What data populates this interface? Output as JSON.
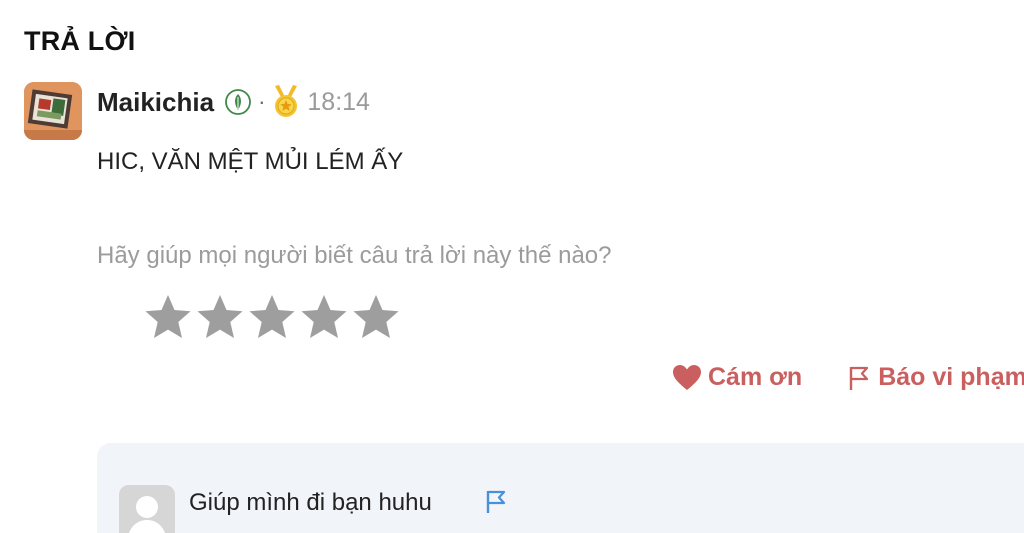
{
  "section": {
    "title": "TRẢ LỜI"
  },
  "answer": {
    "username": "Maikichia",
    "separator": "·",
    "time": "18:14",
    "text": "HIC, VĂN MỆT MỦI LÉM ẤY",
    "rank_icon": "leaf-badge-icon",
    "award_icon": "gold-medal-icon"
  },
  "rating": {
    "prompt": "Hãy giúp mọi người biết câu trả lời này thế nào?",
    "stars_total": 5,
    "stars_filled": 0,
    "star_color": "#9e9e9e"
  },
  "actions": {
    "thanks_label": "Cám ơn",
    "report_label": "Báo vi phạm",
    "accent_color": "#c95f5f"
  },
  "comment": {
    "text": "Giúp mình đi bạn huhu",
    "flag_color": "#4a90d9"
  }
}
